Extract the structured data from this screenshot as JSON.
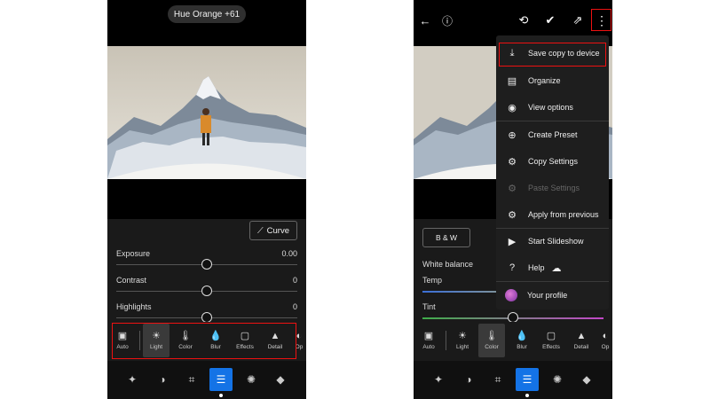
{
  "left": {
    "toast": "Hue Orange +61",
    "curve_button": "Curve",
    "sliders": [
      {
        "label": "Exposure",
        "value": "0.00",
        "level": 0.5
      },
      {
        "label": "Contrast",
        "value": "0",
        "level": 0.5
      },
      {
        "label": "Highlights",
        "value": "0",
        "level": 0.5
      }
    ],
    "tools": [
      {
        "label": "Auto",
        "icon": "auto-icon"
      },
      {
        "label": "Light",
        "icon": "sun-icon"
      },
      {
        "label": "Color",
        "icon": "thermometer-icon"
      },
      {
        "label": "Blur",
        "icon": "blur-drop-icon"
      },
      {
        "label": "Effects",
        "icon": "effects-icon"
      },
      {
        "label": "Detail",
        "icon": "detail-icon"
      },
      {
        "label": "Op",
        "icon": "optics-icon"
      }
    ],
    "active_tool": "Light"
  },
  "right": {
    "bw_button": "B & W",
    "white_balance_label": "White balance",
    "temp_label": "Temp",
    "tint_label": "Tint",
    "menu": [
      {
        "label": "Save copy to device",
        "icon": "download-icon",
        "enabled": true
      },
      {
        "label": "Organize",
        "icon": "organize-icon",
        "enabled": true
      },
      {
        "label": "View options",
        "icon": "eye-icon",
        "enabled": true
      },
      {
        "label": "Create Preset",
        "icon": "create-preset-icon",
        "enabled": true
      },
      {
        "label": "Copy Settings",
        "icon": "copy-settings-icon",
        "enabled": true
      },
      {
        "label": "Paste Settings",
        "icon": "paste-settings-icon",
        "enabled": false
      },
      {
        "label": "Apply from previous",
        "icon": "apply-previous-icon",
        "enabled": true
      },
      {
        "label": "Start Slideshow",
        "icon": "play-icon",
        "enabled": true
      },
      {
        "label": "Help",
        "icon": "help-icon",
        "enabled": true
      },
      {
        "label": "Your profile",
        "icon": "avatar",
        "enabled": true
      }
    ],
    "tools": [
      {
        "label": "Auto",
        "icon": "auto-icon"
      },
      {
        "label": "Light",
        "icon": "sun-icon"
      },
      {
        "label": "Color",
        "icon": "thermometer-icon"
      },
      {
        "label": "Blur",
        "icon": "blur-drop-icon"
      },
      {
        "label": "Effects",
        "icon": "effects-icon"
      },
      {
        "label": "Detail",
        "icon": "detail-icon"
      },
      {
        "label": "Op",
        "icon": "optics-icon"
      }
    ],
    "active_tool": "Color"
  },
  "colors": {
    "accent": "#1473e6",
    "highlight": "#ee1111"
  }
}
